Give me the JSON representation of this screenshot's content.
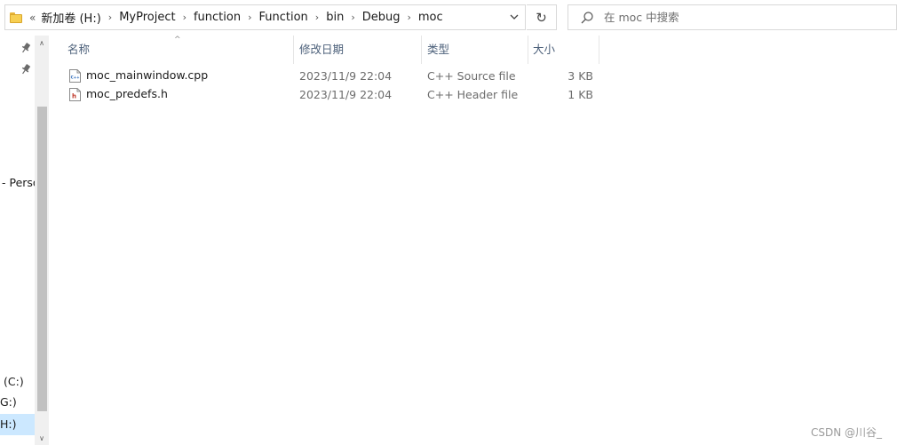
{
  "address_bar": {
    "overflow_glyph": "«",
    "crumbs": [
      "新加卷 (H:)",
      "MyProject",
      "function",
      "Function",
      "bin",
      "Debug",
      "moc"
    ],
    "separator": "›",
    "dropdown_icon": "chevron-down-icon"
  },
  "refresh": {
    "glyph": "↻",
    "icon": "refresh-icon"
  },
  "search": {
    "placeholder": "在 moc 中搜索",
    "icon": "search-icon"
  },
  "nav": {
    "partial_items": [
      "- Perso",
      "(C:)",
      "G:)",
      "H:)"
    ],
    "pins": [
      "pin-icon",
      "pin-icon"
    ]
  },
  "columns": {
    "name": "名称",
    "modified": "修改日期",
    "type": "类型",
    "size": "大小",
    "sort_glyph": "^"
  },
  "files": [
    {
      "name": "moc_mainwindow.cpp",
      "modified": "2023/11/9 22:04",
      "type": "C++ Source file",
      "size": "3 KB",
      "icon": "cpp-file-icon",
      "badge": "C++"
    },
    {
      "name": "moc_predefs.h",
      "modified": "2023/11/9 22:04",
      "type": "C++ Header file",
      "size": "1 KB",
      "icon": "header-file-icon",
      "badge": "h"
    }
  ],
  "scrollbar": {
    "up_glyph": "∧",
    "down_glyph": "∨"
  },
  "watermark": "CSDN @川谷_",
  "colors": {
    "header_text": "#4c607a",
    "secondary_text": "#6d6d6d",
    "selection": "#cce8ff",
    "folder": "#f7cf52"
  }
}
